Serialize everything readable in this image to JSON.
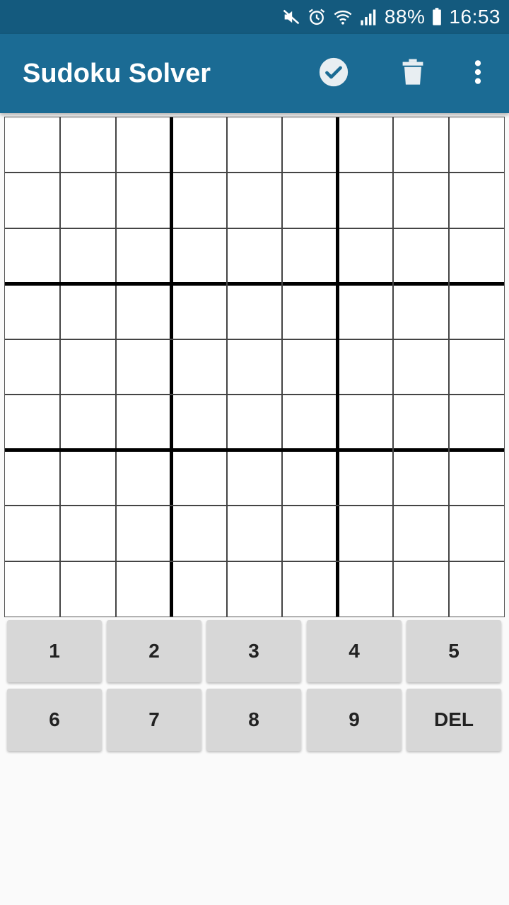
{
  "status_bar": {
    "battery_percent": "88%",
    "time": "16:53",
    "icons": [
      "mute-icon",
      "alarm-icon",
      "wifi-icon",
      "signal-icon",
      "battery-icon"
    ]
  },
  "app_bar": {
    "title": "Sudoku Solver",
    "actions": [
      "check-icon",
      "trash-icon",
      "more-vert-icon"
    ]
  },
  "grid": {
    "size": 9,
    "cells": [
      [
        "",
        "",
        "",
        "",
        "",
        "",
        "",
        "",
        ""
      ],
      [
        "",
        "",
        "",
        "",
        "",
        "",
        "",
        "",
        ""
      ],
      [
        "",
        "",
        "",
        "",
        "",
        "",
        "",
        "",
        ""
      ],
      [
        "",
        "",
        "",
        "",
        "",
        "",
        "",
        "",
        ""
      ],
      [
        "",
        "",
        "",
        "",
        "",
        "",
        "",
        "",
        ""
      ],
      [
        "",
        "",
        "",
        "",
        "",
        "",
        "",
        "",
        ""
      ],
      [
        "",
        "",
        "",
        "",
        "",
        "",
        "",
        "",
        ""
      ],
      [
        "",
        "",
        "",
        "",
        "",
        "",
        "",
        "",
        ""
      ],
      [
        "",
        "",
        "",
        "",
        "",
        "",
        "",
        "",
        ""
      ]
    ]
  },
  "keypad": {
    "keys": [
      "1",
      "2",
      "3",
      "4",
      "5",
      "6",
      "7",
      "8",
      "9",
      "DEL"
    ]
  },
  "colors": {
    "status_bar": "#145a7e",
    "app_bar": "#1b6b94",
    "background": "#fafafa",
    "key_background": "#d7d7d7"
  }
}
